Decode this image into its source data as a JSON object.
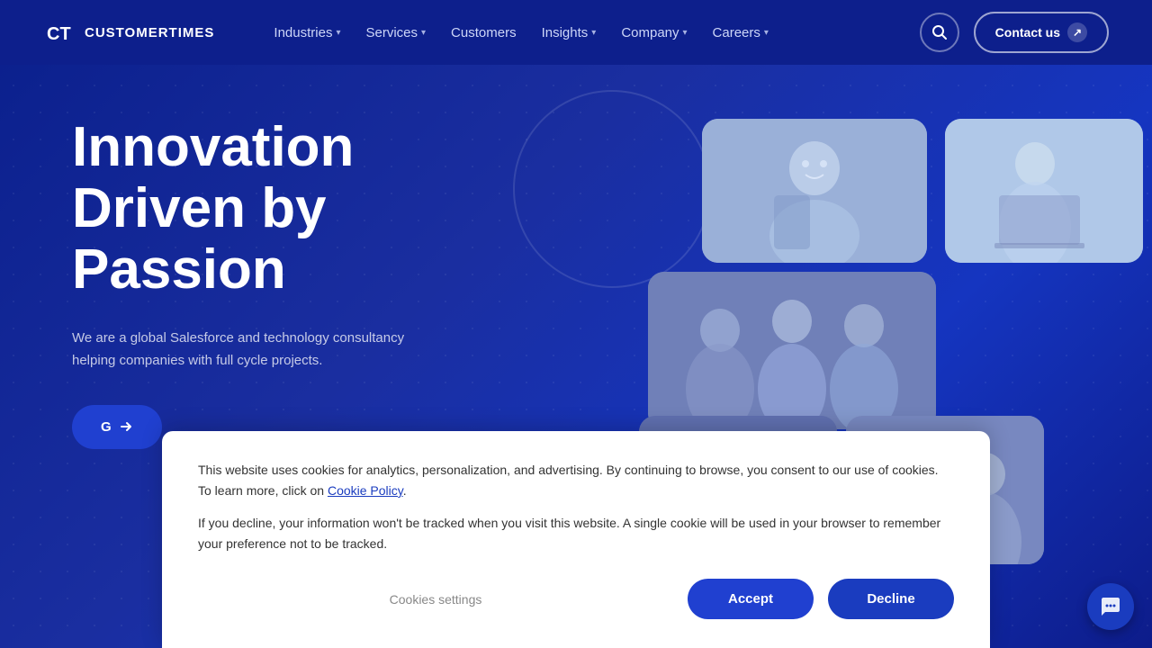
{
  "logo": {
    "text": "CUSTOMERTIMES",
    "icon_label": "ct-logo-icon"
  },
  "nav": {
    "items": [
      {
        "label": "Industries",
        "has_dropdown": true
      },
      {
        "label": "Services",
        "has_dropdown": true
      },
      {
        "label": "Customers",
        "has_dropdown": false
      },
      {
        "label": "Insights",
        "has_dropdown": true
      },
      {
        "label": "Company",
        "has_dropdown": true
      },
      {
        "label": "Careers",
        "has_dropdown": true
      }
    ],
    "search_label": "Search",
    "contact_label": "Contact us"
  },
  "hero": {
    "title": "Innovation Driven by Passion",
    "subtitle": "We are a global Salesforce and technology consultancy helping companies with full cycle projects.",
    "cta_label": "G"
  },
  "cookie": {
    "text1": "This website uses cookies for analytics, personalization, and advertising. By continuing to browse, you consent to our use of cookies. To learn more, click on",
    "link": "Cookie Policy",
    "text1_end": ".",
    "text2": "If you decline, your information won't be tracked when you visit this website. A single cookie will be used in your browser to remember your preference not to be tracked.",
    "settings_label": "Cookies settings",
    "accept_label": "Accept",
    "decline_label": "Decline"
  },
  "colors": {
    "primary": "#0a1f8c",
    "accent": "#2040d0",
    "white": "#ffffff",
    "nav_bg": "#0d1f8c"
  }
}
